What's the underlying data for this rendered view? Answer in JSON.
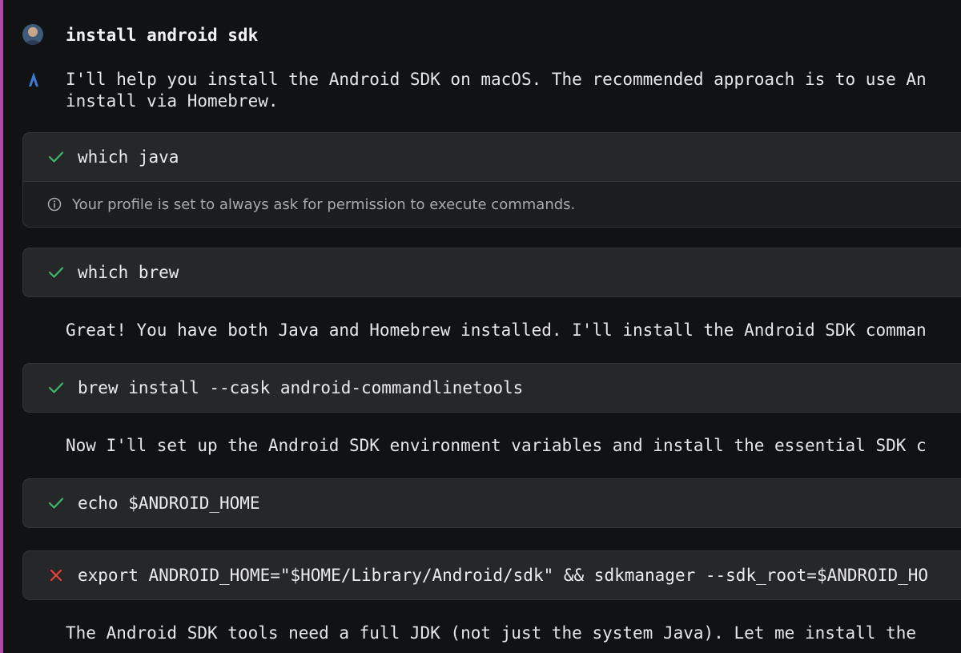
{
  "colors": {
    "accent_bar": "#b04aa8",
    "success": "#3fb76a",
    "error": "#e0443a",
    "background": "#111214",
    "card_bg": "#262729"
  },
  "user_message": {
    "avatar": "user-avatar",
    "text": "install android sdk"
  },
  "assistant": {
    "icon": "assistant-icon",
    "intro_line1": "I'll help you install the Android SDK on macOS. The recommended approach is to use An",
    "intro_line2": "install via Homebrew."
  },
  "commands": [
    {
      "status": "success",
      "status_icon": "check-icon",
      "command": "which java",
      "note_icon": "info-icon",
      "note": "Your profile is set to always ask for permission to execute commands."
    },
    {
      "status": "success",
      "status_icon": "check-icon",
      "command": "which brew"
    },
    {
      "status": "success",
      "status_icon": "check-icon",
      "command": "brew install --cask android-commandlinetools"
    },
    {
      "status": "success",
      "status_icon": "check-icon",
      "command": "echo $ANDROID_HOME"
    },
    {
      "status": "error",
      "status_icon": "x-icon",
      "command": "export ANDROID_HOME=\"$HOME/Library/Android/sdk\" && sdkmanager --sdk_root=$ANDROID_HO"
    }
  ],
  "messages": {
    "after_brew": "Great! You have both Java and Homebrew installed. I'll install the Android SDK comman",
    "after_install": "Now I'll set up the Android SDK environment variables and install the essential SDK c",
    "after_export": "The Android SDK tools need a full JDK (not just the system Java). Let me install the"
  }
}
